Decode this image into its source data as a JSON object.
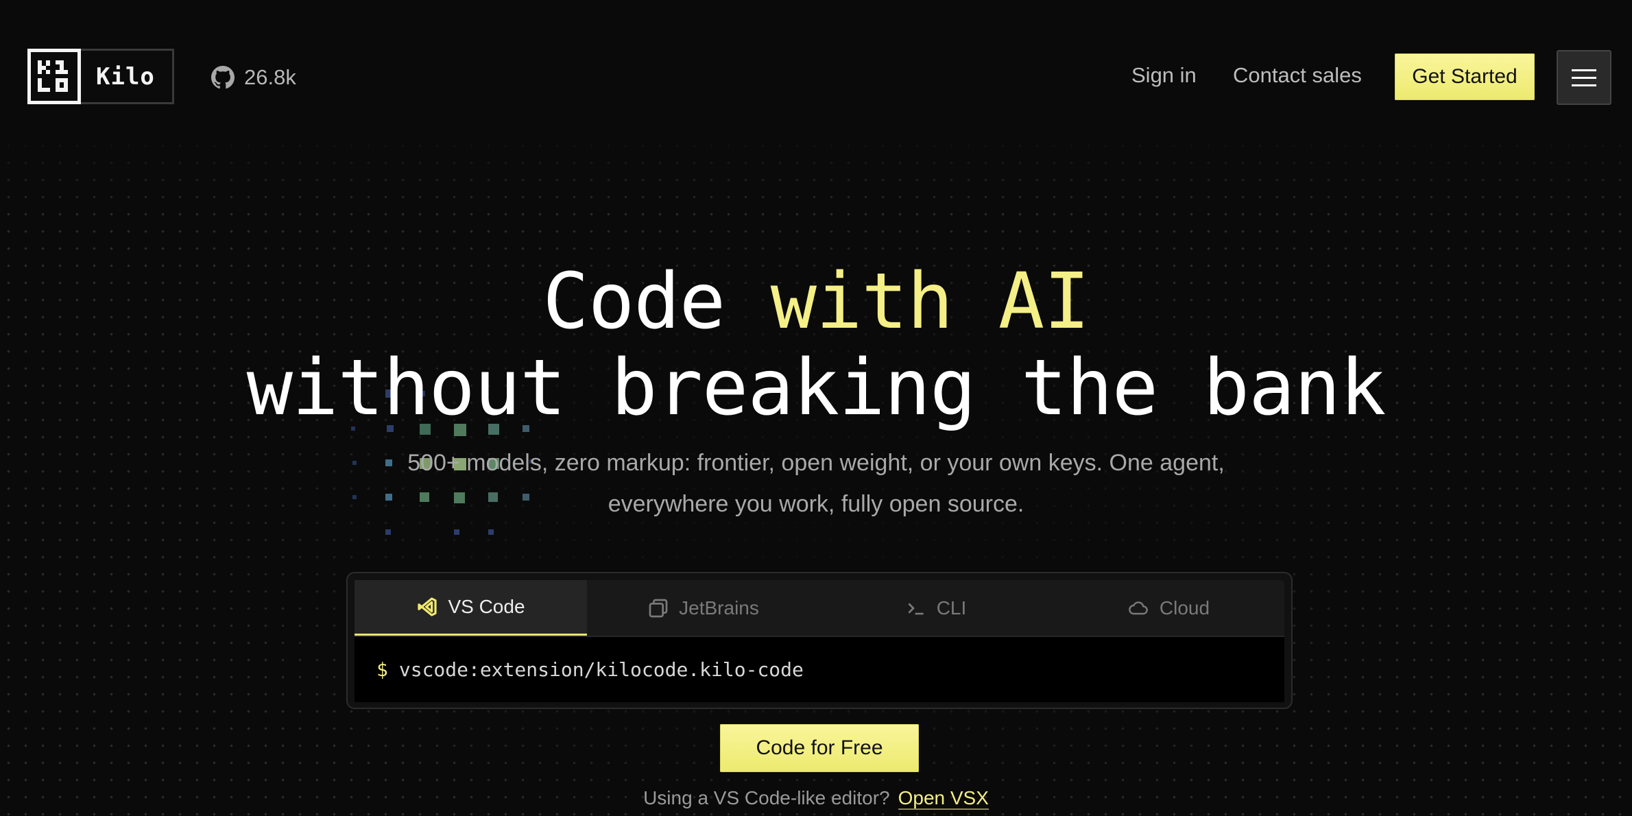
{
  "header": {
    "logo_text": "Kilo",
    "github_stars": "26.8k",
    "nav": {
      "sign_in": "Sign in",
      "contact_sales": "Contact sales",
      "get_started": "Get Started"
    }
  },
  "hero": {
    "headline_part1": "Code ",
    "headline_highlight": "with AI",
    "headline_line2": "without breaking the bank",
    "subtitle_line1": "500+ models, zero markup: frontier, open weight, or your own keys. One agent,",
    "subtitle_line2": "everywhere you work, fully open source."
  },
  "install": {
    "tabs": [
      {
        "label": "VS Code",
        "icon": "vscode-icon",
        "active": true
      },
      {
        "label": "JetBrains",
        "icon": "jetbrains-icon",
        "active": false
      },
      {
        "label": "CLI",
        "icon": "terminal-icon",
        "active": false
      },
      {
        "label": "Cloud",
        "icon": "cloud-icon",
        "active": false
      }
    ],
    "prompt": "$",
    "command": "vscode:extension/kilocode.kilo-code"
  },
  "cta": {
    "label": "Code for Free",
    "footnote": "Using a VS Code-like editor?",
    "link": "Open VSX"
  },
  "colors": {
    "background": "#0a0a0a",
    "accent": "#f4ef86",
    "button": "#f3f07f"
  }
}
